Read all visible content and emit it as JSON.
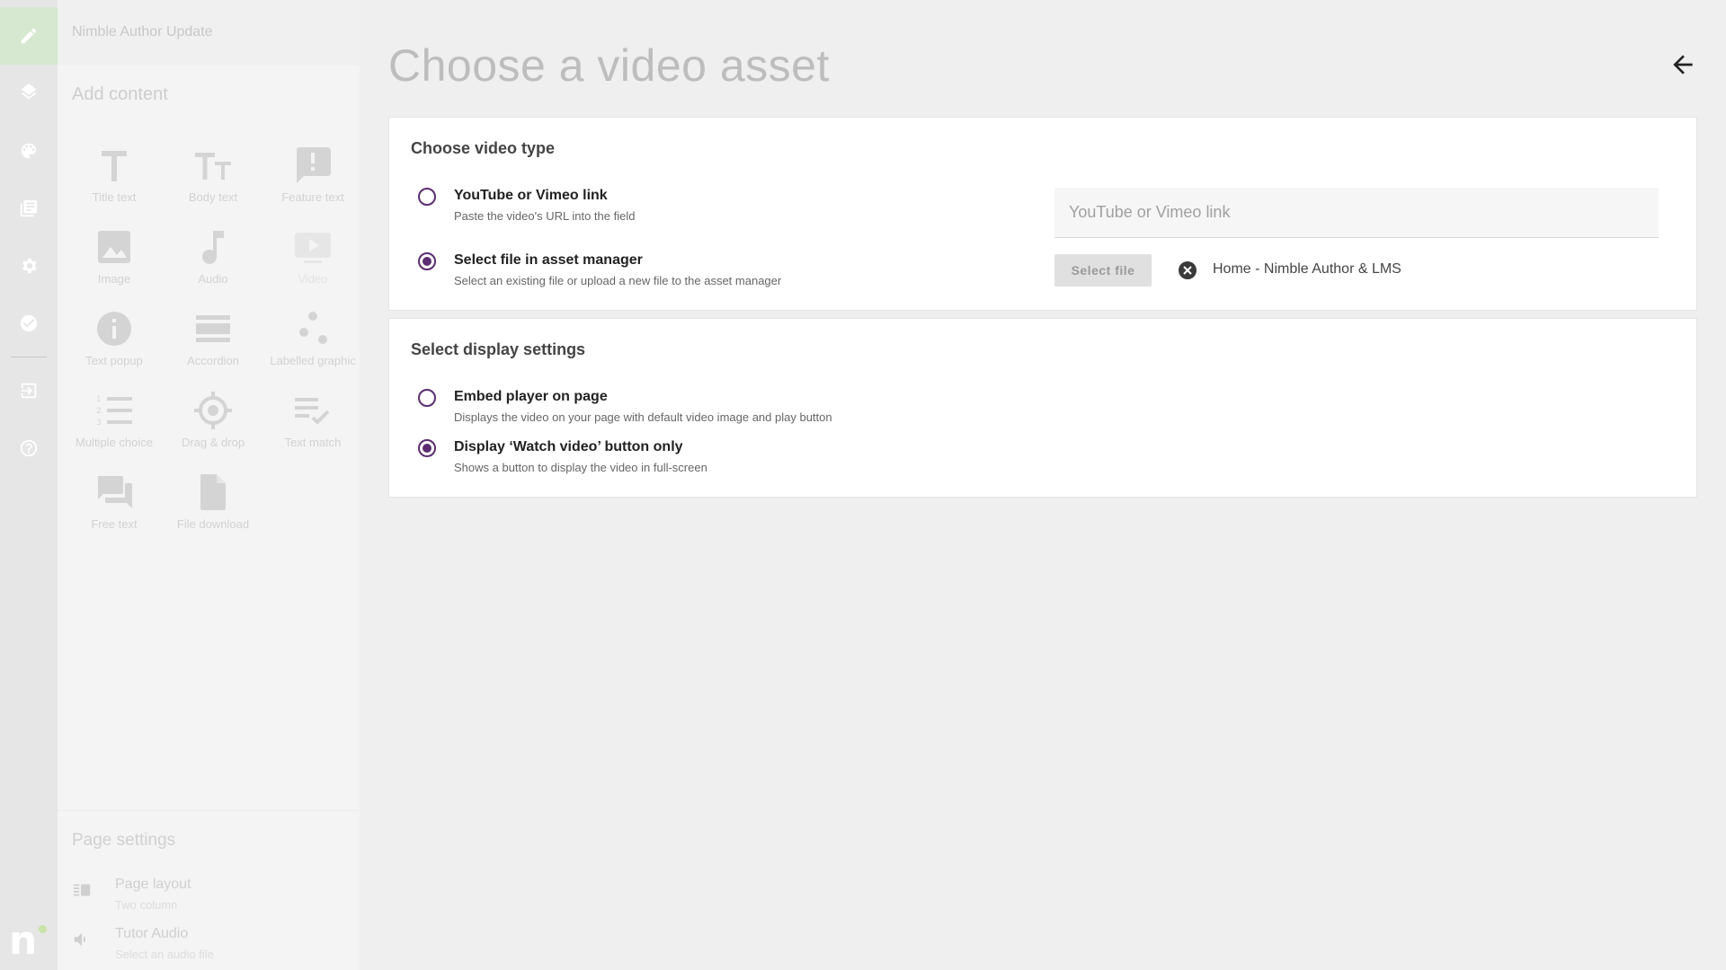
{
  "sidebar_rail": {
    "items": [
      {
        "icon": "pencil-icon",
        "active": true
      },
      {
        "icon": "layers-icon",
        "active": false
      },
      {
        "icon": "palette-icon",
        "active": false
      },
      {
        "icon": "book-icon",
        "active": false
      },
      {
        "icon": "gear-icon",
        "active": false
      },
      {
        "icon": "check-circle-icon",
        "active": false
      },
      {
        "icon": "exit-icon",
        "active": false
      },
      {
        "icon": "help-icon",
        "active": false
      }
    ],
    "brand_letter": "n"
  },
  "panel": {
    "project_title": "Nimble Author Update",
    "add_content_heading": "Add content",
    "tools": [
      {
        "label": "Title text",
        "icon": "title-text-icon"
      },
      {
        "label": "Body text",
        "icon": "body-text-icon"
      },
      {
        "label": "Feature text",
        "icon": "feature-text-icon"
      },
      {
        "label": "Image",
        "icon": "image-icon"
      },
      {
        "label": "Audio",
        "icon": "audio-icon"
      },
      {
        "label": "Video",
        "icon": "video-icon"
      },
      {
        "label": "Text popup",
        "icon": "info-icon"
      },
      {
        "label": "Accordion",
        "icon": "accordion-icon"
      },
      {
        "label": "Labelled graphic",
        "icon": "labelled-graphic-icon"
      },
      {
        "label": "Multiple choice",
        "icon": "numbered-list-icon"
      },
      {
        "label": "Drag & drop",
        "icon": "target-icon"
      },
      {
        "label": "Text match",
        "icon": "text-match-icon"
      },
      {
        "label": "Free text",
        "icon": "chat-icon"
      },
      {
        "label": "File download",
        "icon": "file-icon"
      }
    ],
    "page_settings": {
      "heading": "Page settings",
      "items": [
        {
          "label": "Page layout",
          "sub": "Two column",
          "icon": "layout-icon"
        },
        {
          "label": "Tutor Audio",
          "sub": "Select an audio file",
          "icon": "speaker-icon"
        }
      ]
    }
  },
  "main": {
    "title": "Choose a video asset",
    "video_type": {
      "heading": "Choose video type",
      "options": [
        {
          "label": "YouTube or Vimeo link",
          "desc": "Paste the video's URL into the field",
          "selected": false
        },
        {
          "label": "Select file in asset manager",
          "desc": "Select an existing file or upload a new file to the asset manager",
          "selected": true
        }
      ],
      "url_placeholder": "YouTube or Vimeo link",
      "select_file_label": "Select file",
      "selected_file_name": "Home - Nimble Author & LMS"
    },
    "display": {
      "heading": "Select display settings",
      "options": [
        {
          "label": "Embed player on page",
          "desc": "Displays the video on your page with default video image and play button",
          "selected": false
        },
        {
          "label": "Display ‘Watch video’ button only",
          "desc": "Shows a button to display the video in full-screen",
          "selected": true
        }
      ]
    }
  },
  "colors": {
    "accent": "#5c2c72",
    "rail_active": "#d6e8cf"
  }
}
